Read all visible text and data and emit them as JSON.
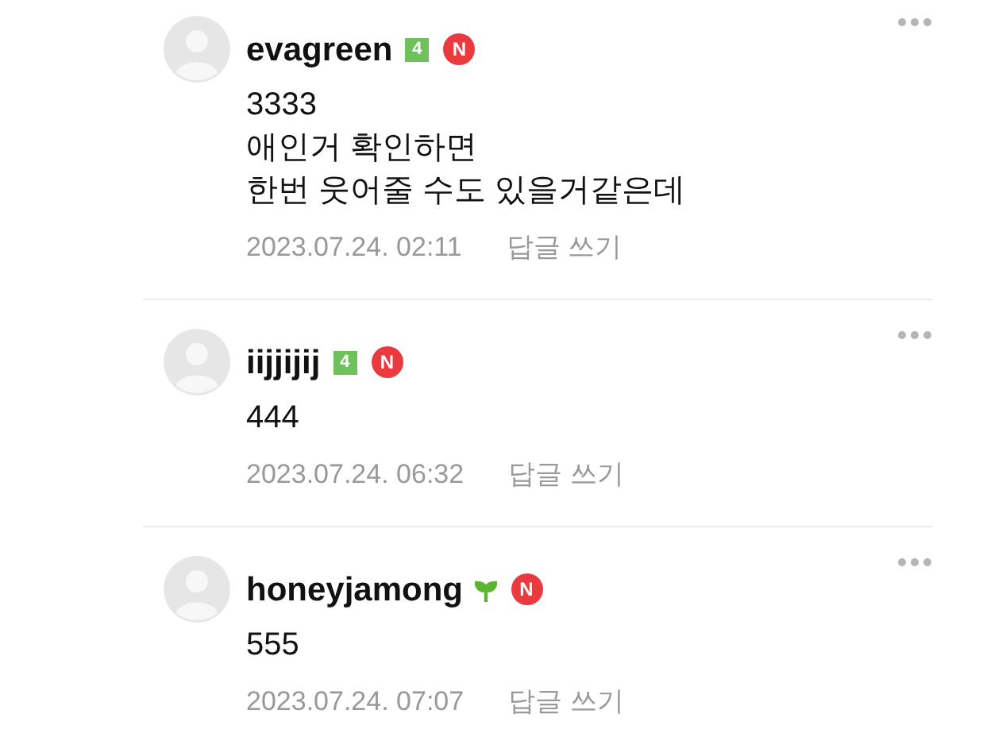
{
  "comments": [
    {
      "author": "evagreen",
      "badge": {
        "kind": "level",
        "text": "4"
      },
      "n_mark": "N",
      "lines": [
        "3333",
        "애인거 확인하면",
        "한번 웃어줄 수도 있을거같은데"
      ],
      "date": "2023.07.24. 02:11",
      "reply": "답글 쓰기"
    },
    {
      "author": "iijjijij",
      "badge": {
        "kind": "level",
        "text": "4"
      },
      "n_mark": "N",
      "lines": [
        "444"
      ],
      "date": "2023.07.24. 06:32",
      "reply": "답글 쓰기"
    },
    {
      "author": "honeyjamong",
      "badge": {
        "kind": "sprout"
      },
      "n_mark": "N",
      "lines": [
        "555"
      ],
      "date": "2023.07.24. 07:07",
      "reply": "답글 쓰기"
    }
  ]
}
